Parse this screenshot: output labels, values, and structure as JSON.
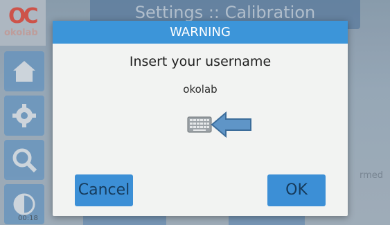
{
  "background": {
    "header_title": "Settings :: Calibration",
    "logo_text": "okolab",
    "right_fragment": "rmed",
    "time": "00:18",
    "sidebar": [
      {
        "icon": "home-icon"
      },
      {
        "icon": "gear-icon"
      },
      {
        "icon": "search-icon"
      },
      {
        "icon": "contrast-icon"
      }
    ]
  },
  "dialog": {
    "title": "WARNING",
    "prompt": "Insert your username",
    "username": "okolab",
    "keyboard_icon": "keyboard-icon",
    "annotation_icon": "arrow-left-icon",
    "cancel_label": "Cancel",
    "ok_label": "OK"
  },
  "colors": {
    "accent": "#3c95d9",
    "button": "#3c8fd6",
    "dialog_bg": "#f2f3f2"
  }
}
